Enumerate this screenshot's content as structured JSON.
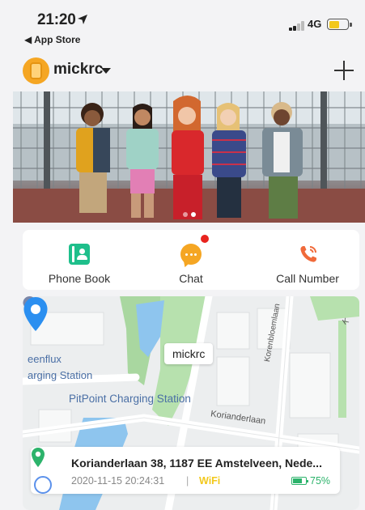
{
  "status_bar": {
    "time": "21:20",
    "back_app": "◀ App Store",
    "network": "4G",
    "battery_color": "#f2c81c"
  },
  "header": {
    "device_name": "mickrc",
    "avatar_icon": "watch-icon",
    "add_icon": "plus-icon"
  },
  "banner": {
    "slide_count": 2,
    "active_slide": 1
  },
  "actions": [
    {
      "label": "Phone Book",
      "icon": "phonebook-icon",
      "color": "#1ebf8b"
    },
    {
      "label": "Chat",
      "icon": "chat-icon",
      "color": "#f5a623",
      "badge": true,
      "badge_color": "#e8231e"
    },
    {
      "label": "Call Number",
      "icon": "phone-call-icon",
      "color": "#f06a3a"
    }
  ],
  "map": {
    "poi_labels": [
      "eenflux",
      "arging Station",
      "PitPoint Charging Station"
    ],
    "streets": [
      "Korianderlaan",
      "Korenbloemlaan",
      "K"
    ],
    "marker_name": "mickrc",
    "marker_color": "#2b8ff0"
  },
  "location": {
    "address": "Korianderlaan 38, 1187 EE Amstelveen, Nede...",
    "timestamp": "2020-11-15 20:24:31",
    "separator": "|",
    "source": "WiFi",
    "source_color": "#f2c81c",
    "battery": "75%",
    "battery_level": 0.75,
    "battery_color": "#2cb36b",
    "pin_color": "#2cb36b"
  }
}
